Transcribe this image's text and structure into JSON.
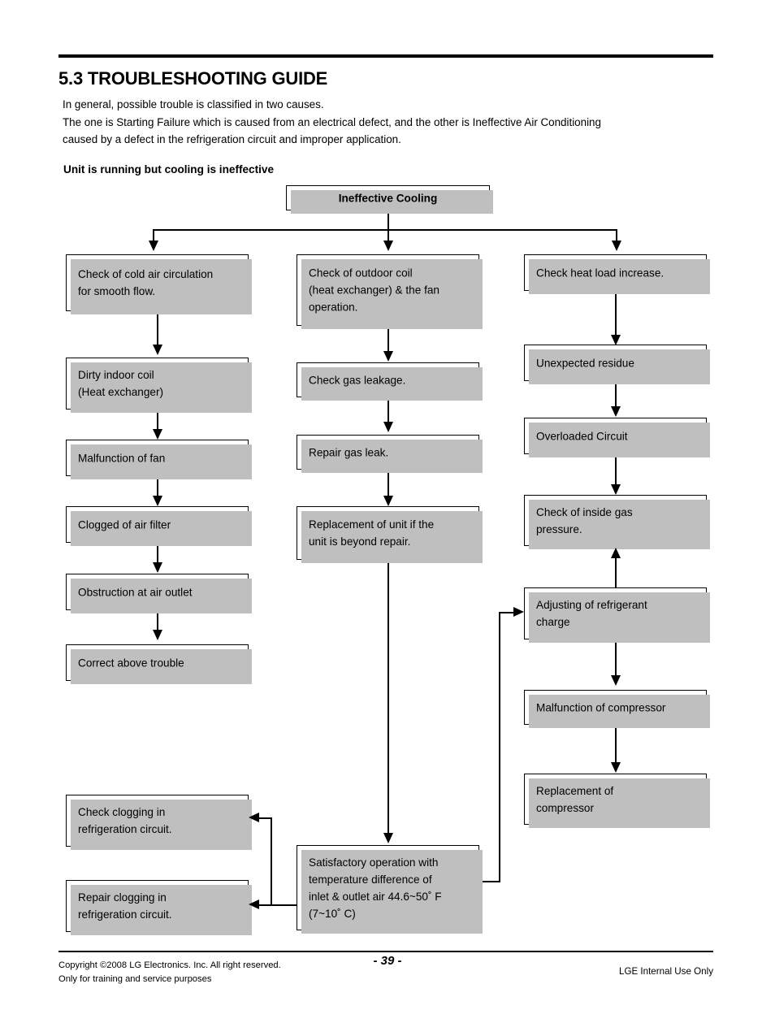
{
  "document": {
    "section_number_title": "5.3 TROUBLESHOOTING GUIDE",
    "intro_line_1": "In general, possible trouble is classified in two causes.",
    "intro_line_2": "The one is Starting Failure which is caused from an electrical defect, and the other is Ineffective Air Conditioning",
    "intro_line_3": "caused by a defect in the refrigeration circuit and improper application.",
    "subheading": "Unit is running but cooling is ineffective"
  },
  "flowchart": {
    "root": "Ineffective Cooling",
    "branch_left": [
      "Check of cold  air circulation\nfor smooth flow.",
      "Dirty indoor coil\n(Heat exchanger)",
      "Malfunction of fan",
      "Clogged of air filter",
      "Obstruction at air outlet",
      "Correct above trouble"
    ],
    "branch_middle": [
      "Check of outdoor coil\n(heat exchanger) & the fan\noperation.",
      "Check gas leakage.",
      "Repair gas leak.",
      "Replacement of unit if the\nunit is beyond repair."
    ],
    "branch_right": [
      "Check heat load increase.",
      "Unexpected residue",
      "Overloaded Circuit",
      "Check of inside gas\npressure.",
      "Adjusting of refrigerant\ncharge",
      "Malfunction of compressor",
      "Replacement of\ncompressor"
    ],
    "outcome": "Satisfactory operation with\ntemperature difference of\ninlet & outlet air  44.6~50˚ F\n(7~10˚ C)",
    "remedies": [
      "Check clogging in\nrefrigeration circuit.",
      "Repair clogging in\nrefrigeration circuit."
    ]
  },
  "footer": {
    "copyright_line_1": "Copyright ©2008 LG Electronics. Inc. All right reserved.",
    "copyright_line_2": "Only for training and service purposes",
    "page_number": "- 39 -",
    "internal_notice": "LGE Internal Use Only"
  }
}
